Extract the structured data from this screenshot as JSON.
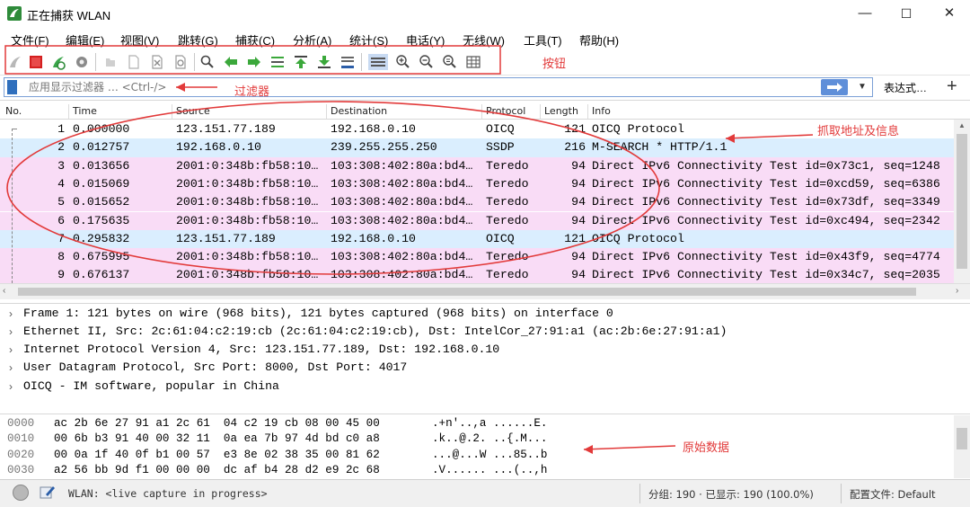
{
  "window": {
    "title": "正在捕获 WLAN",
    "minimize": "—",
    "maximize": "☐",
    "close": "✕"
  },
  "menu": [
    "文件(F)",
    "编辑(E)",
    "视图(V)",
    "跳转(G)",
    "捕获(C)",
    "分析(A)",
    "统计(S)",
    "电话(Y)",
    "无线(W)",
    "工具(T)",
    "帮助(H)"
  ],
  "toolbar": {
    "icons": [
      "shark-fin-start-icon",
      "stop-square-icon",
      "restart-shark-icon",
      "gear-options-icon",
      "open-file-icon",
      "save-file-icon",
      "close-file-icon",
      "reload-icon",
      "search-icon",
      "back-arrow-icon",
      "forward-arrow-icon",
      "goto-packet-icon",
      "first-packet-icon",
      "last-packet-icon",
      "autoscroll-icon",
      "colorize-icon",
      "zoom-in-icon",
      "zoom-out-icon",
      "zoom-normal-icon",
      "resize-columns-icon"
    ]
  },
  "filter": {
    "placeholder": "应用显示过滤器 … <Ctrl-/>",
    "expression_label": "表达式…",
    "add_label": "+"
  },
  "packet_list": {
    "columns": [
      "No.",
      "Time",
      "Source",
      "Destination",
      "Protocol",
      "Length",
      "Info"
    ],
    "rows": [
      {
        "no": "1",
        "time": "0.000000",
        "source": "123.151.77.189",
        "destination": "192.168.0.10",
        "protocol": "OICQ",
        "length": "121",
        "info": "OICQ Protocol",
        "bg": "#ffffff"
      },
      {
        "no": "2",
        "time": "0.012757",
        "source": "192.168.0.10",
        "destination": "239.255.255.250",
        "protocol": "SSDP",
        "length": "216",
        "info": "M-SEARCH * HTTP/1.1",
        "bg": "#daeefe"
      },
      {
        "no": "3",
        "time": "0.013656",
        "source": "2001:0:348b:fb58:10…",
        "destination": "103:308:402:80a:bd4…",
        "protocol": "Teredo",
        "length": "94",
        "info": "Direct IPv6 Connectivity Test id=0x73c1, seq=1248",
        "bg": "#f9dcf6"
      },
      {
        "no": "4",
        "time": "0.015069",
        "source": "2001:0:348b:fb58:10…",
        "destination": "103:308:402:80a:bd4…",
        "protocol": "Teredo",
        "length": "94",
        "info": "Direct IPv6 Connectivity Test id=0xcd59, seq=6386",
        "bg": "#f9dcf6"
      },
      {
        "no": "5",
        "time": "0.015652",
        "source": "2001:0:348b:fb58:10…",
        "destination": "103:308:402:80a:bd4…",
        "protocol": "Teredo",
        "length": "94",
        "info": "Direct IPv6 Connectivity Test id=0x73df, seq=3349",
        "bg": "#f9dcf6"
      },
      {
        "no": "6",
        "time": "0.175635",
        "source": "2001:0:348b:fb58:10…",
        "destination": "103:308:402:80a:bd4…",
        "protocol": "Teredo",
        "length": "94",
        "info": "Direct IPv6 Connectivity Test id=0xc494, seq=2342",
        "bg": "#f9dcf6"
      },
      {
        "no": "7",
        "time": "0.295832",
        "source": "123.151.77.189",
        "destination": "192.168.0.10",
        "protocol": "OICQ",
        "length": "121",
        "info": "OICQ Protocol",
        "bg": "#daeefe"
      },
      {
        "no": "8",
        "time": "0.675995",
        "source": "2001:0:348b:fb58:10…",
        "destination": "103:308:402:80a:bd4…",
        "protocol": "Teredo",
        "length": "94",
        "info": "Direct IPv6 Connectivity Test id=0x43f9, seq=4774",
        "bg": "#f9dcf6"
      },
      {
        "no": "9",
        "time": "0.676137",
        "source": "2001:0:348b:fb58:10…",
        "destination": "103:308:402:80a:bd4…",
        "protocol": "Teredo",
        "length": "94",
        "info": "Direct IPv6 Connectivity Test id=0x34c7, seq=2035",
        "bg": "#f9dcf6"
      }
    ]
  },
  "details": [
    "Frame 1: 121 bytes on wire (968 bits), 121 bytes captured (968 bits) on interface 0",
    "Ethernet II, Src: 2c:61:04:c2:19:cb (2c:61:04:c2:19:cb), Dst: IntelCor_27:91:a1 (ac:2b:6e:27:91:a1)",
    "Internet Protocol Version 4, Src: 123.151.77.189, Dst: 192.168.0.10",
    "User Datagram Protocol, Src Port: 8000, Dst Port: 4017",
    "OICQ - IM software, popular in China"
  ],
  "bytes": [
    {
      "offset": "0000",
      "hex": "ac 2b 6e 27 91 a1 2c 61  04 c2 19 cb 08 00 45 00",
      "ascii": ".+n'..,a ......E."
    },
    {
      "offset": "0010",
      "hex": "00 6b b3 91 40 00 32 11  0a ea 7b 97 4d bd c0 a8",
      "ascii": ".k..@.2. ..{.M..."
    },
    {
      "offset": "0020",
      "hex": "00 0a 1f 40 0f b1 00 57  e3 8e 02 38 35 00 81 62",
      "ascii": "...@...W ...85..b"
    },
    {
      "offset": "0030",
      "hex": "a2 56 bb 9d f1 00 00 00  dc af b4 28 d2 e9 2c 68",
      "ascii": ".V...... ...(..,h"
    }
  ],
  "status": {
    "capture": "WLAN: <live capture in progress>",
    "packets": "分组: 190 · 已显示: 190 (100.0%)",
    "profile": "配置文件: Default"
  },
  "annotations": {
    "buttons": "按钮",
    "filter": "过滤器",
    "capture_info": "抓取地址及信息",
    "raw_data": "原始数据"
  },
  "colors": {
    "annotation": "#e23a3a",
    "row_udp": "#daeefe",
    "row_teredo": "#f9dcf6"
  }
}
